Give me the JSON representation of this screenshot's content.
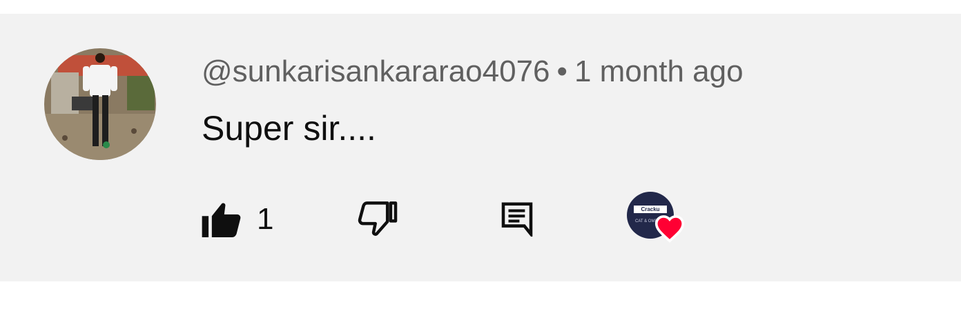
{
  "comment": {
    "author": "@sunkarisankararao4076",
    "separator": "•",
    "time": "1 month ago",
    "text": "Super sir....",
    "likes": "1"
  },
  "creator_heart": {
    "logo_text": "Cracku",
    "tag_text": "CAT & OMETS"
  },
  "icons": {
    "like": "thumbs-up-icon",
    "dislike": "thumbs-down-icon",
    "reply": "comment-icon",
    "heart": "heart-icon"
  },
  "colors": {
    "background": "#f2f2f2",
    "meta_text": "#606060",
    "primary_text": "#0f0f0f",
    "heart": "#ff0033",
    "creator_avatar": "#22284a"
  }
}
